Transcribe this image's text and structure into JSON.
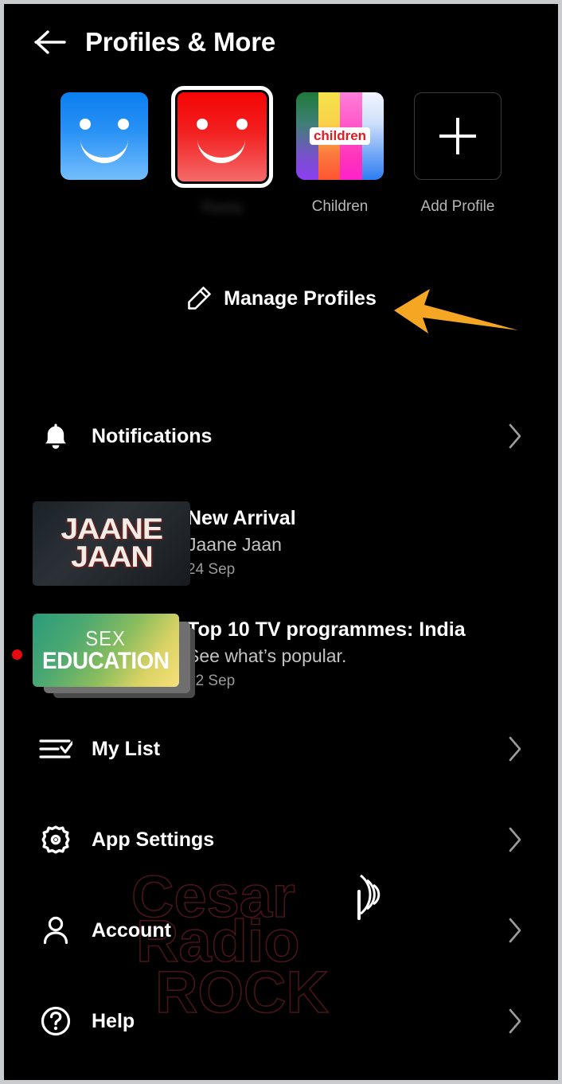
{
  "header": {
    "back_icon": "arrow-left-icon",
    "title": "Profiles & More"
  },
  "profiles": {
    "items": [
      {
        "name": "",
        "avatar_type": "smiley-blue",
        "selected": false,
        "label_hidden": true
      },
      {
        "name": "Reeta",
        "avatar_type": "smiley-red",
        "selected": true,
        "label_redacted": true
      },
      {
        "name": "Children",
        "avatar_type": "children-stripes",
        "badge": "children",
        "selected": false
      },
      {
        "name": "Add Profile",
        "avatar_type": "add-plus",
        "selected": false
      }
    ],
    "manage": {
      "icon": "pencil-edit-icon",
      "label": "Manage Profiles"
    }
  },
  "annotation": {
    "arrow_color": "#f5a623",
    "points_to": "Manage Profiles"
  },
  "menu": {
    "notifications": {
      "icon": "bell-icon",
      "label": "Notifications",
      "chevron": "chevron-right-icon"
    },
    "my_list": {
      "icon": "checklist-icon",
      "label": "My List",
      "chevron": "chevron-right-icon"
    },
    "app_settings": {
      "icon": "gear-icon",
      "label": "App Settings",
      "chevron": "chevron-right-icon"
    },
    "account": {
      "icon": "person-icon",
      "label": "Account",
      "chevron": "chevron-right-icon"
    },
    "help": {
      "icon": "question-circle-icon",
      "label": "Help",
      "chevron": "chevron-right-icon"
    }
  },
  "notifications": [
    {
      "title": "New Arrival",
      "subtitle": "Jaane Jaan",
      "date": "24 Sep",
      "thumb_line1": "JAANE",
      "thumb_line2": "JAAN",
      "unread": false
    },
    {
      "title": "Top 10 TV programmes: India",
      "subtitle": "See what’s popular.",
      "date": "22 Sep",
      "thumb_line1": "SEX",
      "thumb_line2": "EDUCATION",
      "unread": true
    }
  ],
  "watermark": {
    "line1": "Cesar",
    "line2": "Radio",
    "line3": "Rock",
    "icon": "broadcast-signal-icon",
    "color": "#3a0d10"
  },
  "colors": {
    "background": "#000000",
    "frame": "#c9cbcf",
    "accent_red": "#e50914",
    "arrow": "#f5a623",
    "text_primary": "#ffffff",
    "text_secondary": "#b6b6b6"
  }
}
